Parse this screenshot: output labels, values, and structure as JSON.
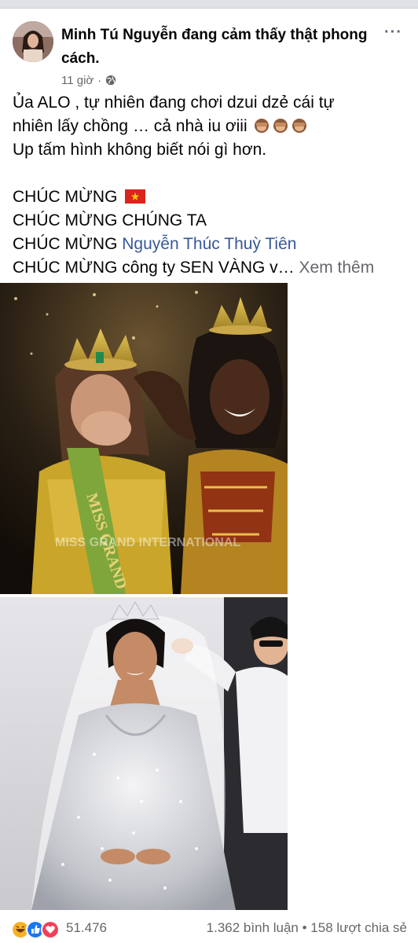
{
  "header": {
    "author_name": "Minh Tú Nguyễn",
    "feeling_text": " đang cảm thấy thật phong cách.",
    "time": "11 giờ",
    "dot": "·",
    "more_icon": "···"
  },
  "post": {
    "line1": "Ủa ALO , tự nhiên đang  chơi dzui dzẻ cái tự",
    "line2": "nhiên lấy chồng … cả nhà iu ơiii",
    "line3": "Up tấm hình không biết nói gì hơn.",
    "line4": "CHÚC MỪNG",
    "line5": "CHÚC MỪNG CHÚNG TA",
    "line6_prefix": "CHÚC MỪNG ",
    "line6_mention": "Nguyễn Thúc Thuỳ Tiên",
    "line7": "CHÚC MỪNG công ty SEN VÀNG v…",
    "see_more": " Xem thêm"
  },
  "photos": {
    "photo1_sash_text": "MISS GRAND",
    "photo1_watermark": "MISS GRAND INTERNATIONAL"
  },
  "footer": {
    "reaction_count": "51.476",
    "comments_shares": "1.362 bình luận • 158 lượt chia sẻ"
  },
  "colors": {
    "text": "#050505",
    "secondary": "#65676b",
    "mention": "#385898",
    "like_blue": "#1877f2",
    "love_red": "#f33e58",
    "haha_yellow": "#f7b125"
  }
}
